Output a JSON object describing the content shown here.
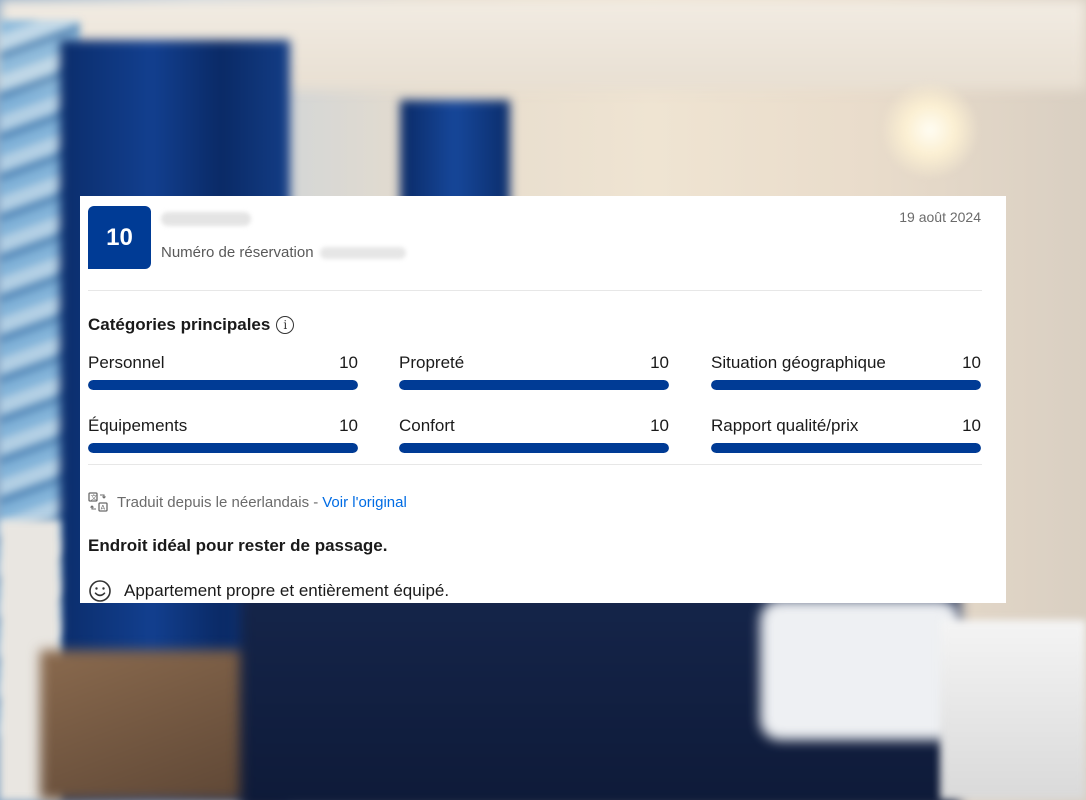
{
  "review": {
    "score": "10",
    "booking_label": "Numéro de réservation",
    "date": "19 août 2024",
    "categories_title": "Catégories principales",
    "categories": [
      {
        "label": "Personnel",
        "value": "10",
        "fill": 1.0
      },
      {
        "label": "Propreté",
        "value": "10",
        "fill": 1.0
      },
      {
        "label": "Situation géographique",
        "value": "10",
        "fill": 1.0
      },
      {
        "label": "Équipements",
        "value": "10",
        "fill": 1.0
      },
      {
        "label": "Confort",
        "value": "10",
        "fill": 1.0
      },
      {
        "label": "Rapport qualité/prix",
        "value": "10",
        "fill": 1.0
      }
    ],
    "translated_note": "Traduit depuis le néerlandais -",
    "see_original": "Voir l'original",
    "title": "Endroit idéal pour rester de passage.",
    "positive_text": "Appartement propre et entièrement équipé."
  },
  "colors": {
    "brand_blue": "#003b95",
    "link_blue": "#006ce4"
  },
  "icons": [
    "info-icon",
    "translate-icon",
    "smile-icon"
  ]
}
